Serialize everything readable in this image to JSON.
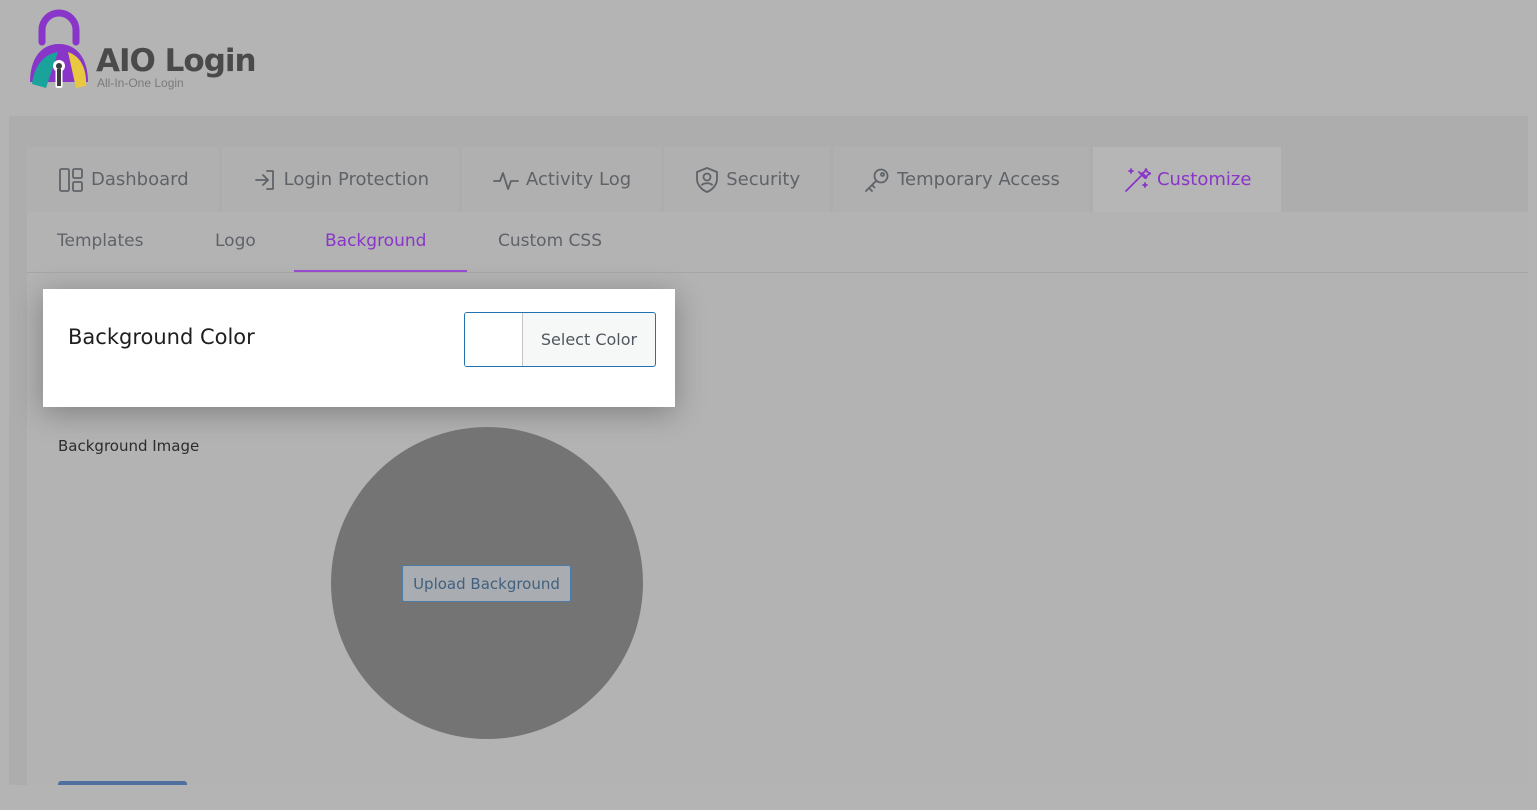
{
  "brand": {
    "title": "AIO Login",
    "subtitle": "All-In-One Login",
    "colors": {
      "purple": "#8a35c9",
      "teal": "#1aa39a",
      "yellow": "#e8c840",
      "gray": "#4a4a4a"
    }
  },
  "tabs": [
    {
      "label": "Dashboard",
      "icon": "dashboard-icon"
    },
    {
      "label": "Login Protection",
      "icon": "login-arrow-icon"
    },
    {
      "label": "Activity Log",
      "icon": "activity-icon"
    },
    {
      "label": "Security",
      "icon": "shield-user-icon"
    },
    {
      "label": "Temporary Access",
      "icon": "key-icon"
    },
    {
      "label": "Customize",
      "icon": "magic-wand-icon",
      "active": true
    }
  ],
  "subtabs": [
    {
      "label": "Templates"
    },
    {
      "label": "Logo"
    },
    {
      "label": "Background",
      "active": true
    },
    {
      "label": "Custom CSS"
    }
  ],
  "background_color": {
    "label": "Background Color",
    "picker_label": "Select Color",
    "value": "#ffffff"
  },
  "background_image": {
    "label": "Background Image",
    "upload_label": "Upload Background"
  }
}
